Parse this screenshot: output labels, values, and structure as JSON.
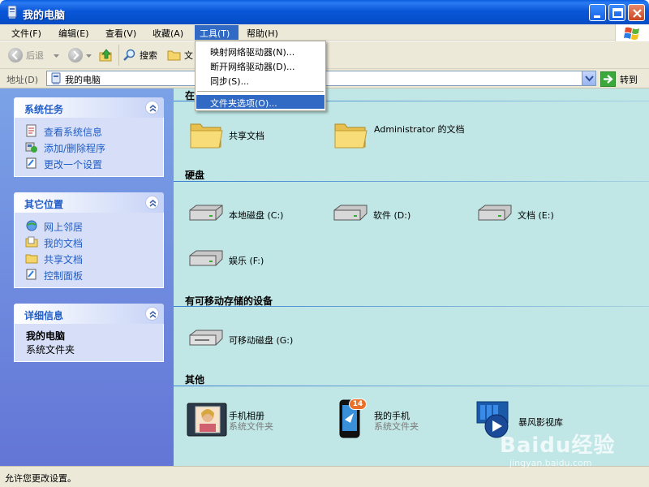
{
  "window": {
    "title": "我的电脑"
  },
  "menubar": {
    "items": [
      "文件(F)",
      "编辑(E)",
      "查看(V)",
      "收藏(A)",
      "工具(T)",
      "帮助(H)"
    ],
    "active_index": 4
  },
  "toolbar": {
    "back": "后退",
    "search": "搜索",
    "folders_truncated": "文"
  },
  "addressbar": {
    "label": "地址(D)",
    "value": "我的电脑",
    "go": "转到"
  },
  "tools_menu": {
    "items": [
      "映射网络驱动器(N)...",
      "断开网络驱动器(D)...",
      "同步(S)...",
      "文件夹选项(O)..."
    ],
    "highlighted_index": 3
  },
  "left_panels": {
    "system_tasks": {
      "title": "系统任务",
      "links": [
        "查看系统信息",
        "添加/删除程序",
        "更改一个设置"
      ]
    },
    "other_places": {
      "title": "其它位置",
      "links": [
        "网上邻居",
        "我的文档",
        "共享文档",
        "控制面板"
      ]
    },
    "details": {
      "title": "详细信息",
      "name": "我的电脑",
      "type": "系统文件夹"
    }
  },
  "groups": {
    "files": {
      "title": "在",
      "items": [
        "共享文档",
        "Administrator 的文档"
      ]
    },
    "hdd": {
      "title": "硬盘",
      "items": [
        "本地磁盘 (C:)",
        "软件 (D:)",
        "文档 (E:)",
        "娱乐 (F:)"
      ]
    },
    "removable": {
      "title": "有可移动存储的设备",
      "items": [
        "可移动磁盘 (G:)"
      ]
    },
    "other": {
      "title": "其他",
      "items": [
        {
          "name": "手机相册",
          "sub": "系统文件夹"
        },
        {
          "name": "我的手机",
          "sub": "系统文件夹"
        },
        {
          "name": "暴风影视库",
          "sub": ""
        }
      ],
      "badge": "14"
    }
  },
  "statusbar": {
    "text": "允许您更改设置。"
  },
  "watermark": {
    "brand": "Baidu经验",
    "url": "jingyan.baidu.com"
  },
  "colors": {
    "xp_blue": "#0a56d8",
    "menu_highlight": "#316ac5",
    "link": "#215dc6",
    "main_bg": "#c0e6e6"
  }
}
